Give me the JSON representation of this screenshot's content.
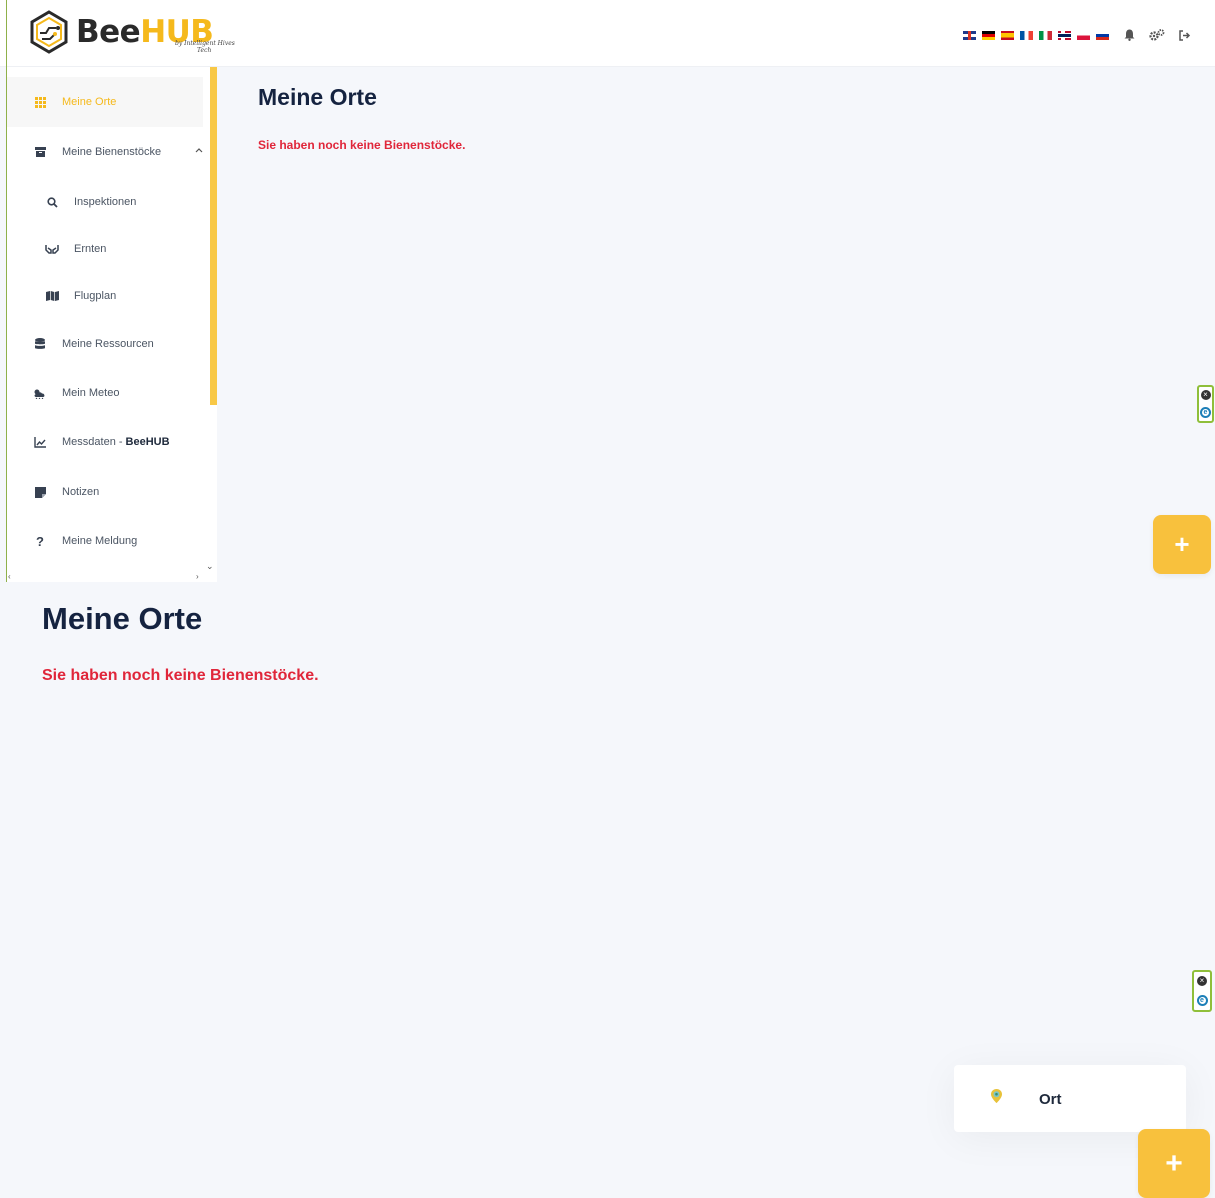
{
  "header": {
    "logo_bee": "Bee",
    "logo_hub": "HUB",
    "logo_sub1": "by Intelligent Hives",
    "logo_sub2": "Tech",
    "languages": [
      "gb",
      "de",
      "es",
      "fr",
      "it",
      "no",
      "pl",
      "ru"
    ]
  },
  "sidebar": {
    "items": [
      {
        "label": "Meine Orte",
        "icon": "grid-icon",
        "active": true
      },
      {
        "label": "Meine Bienenstöcke",
        "icon": "archive-icon"
      },
      {
        "label": "Inspektionen",
        "icon": "search-icon"
      },
      {
        "label": "Ernten",
        "icon": "hands-icon"
      },
      {
        "label": "Flugplan",
        "icon": "map-icon"
      },
      {
        "label": "Meine Ressourcen",
        "icon": "database-icon"
      },
      {
        "label": "Mein Meteo",
        "icon": "cloud-sun-icon"
      },
      {
        "label": "Messdaten - ",
        "bold": "BeeHUB",
        "icon": "chart-line-icon"
      },
      {
        "label": "Notizen",
        "icon": "note-icon"
      },
      {
        "label": "Meine Meldung",
        "icon": "question-icon"
      }
    ]
  },
  "main": {
    "title": "Meine Orte",
    "empty_message": "Sie haben noch keine Bienenstöcke.",
    "fab_label": "+"
  },
  "fab_menu": {
    "items": [
      {
        "label": "Ort",
        "icon": "location-pin-icon"
      }
    ]
  },
  "colors": {
    "accent": "#f5b91c",
    "title": "#152340",
    "error": "#e0263a",
    "background": "#f5f7fb"
  }
}
